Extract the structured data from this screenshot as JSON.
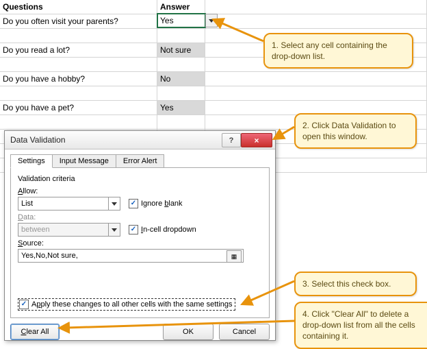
{
  "sheet": {
    "headers": {
      "q": "Questions",
      "a": "Answer"
    },
    "rows": [
      {
        "q": "Do you often visit your parents?",
        "a": "Yes"
      },
      {
        "q": "Do you read a lot?",
        "a": "Not sure"
      },
      {
        "q": "Do you have a hobby?",
        "a": "No"
      },
      {
        "q": "Do you have a pet?",
        "a": "Yes"
      }
    ],
    "selected_answer": "Yes"
  },
  "dialog": {
    "title": "Data Validation",
    "help": "?",
    "close": "×",
    "tabs": {
      "settings": "Settings",
      "input": "Input Message",
      "error": "Error Alert"
    },
    "criteria_title": "Validation criteria",
    "allow_label": "Allow:",
    "allow_value": "List",
    "data_label": "Data:",
    "data_value": "between",
    "ignore_blank": "Ignore blank",
    "incell": "In-cell dropdown",
    "source_label": "Source:",
    "source_value": "Yes,No,Not sure,",
    "apply_label": "Apply these changes to all other cells with the same settings",
    "buttons": {
      "clear": "Clear All",
      "ok": "OK",
      "cancel": "Cancel"
    }
  },
  "callouts": {
    "c1": "1. Select any cell containing the drop-down list.",
    "c2": "2. Click Data Validation to open this window.",
    "c3": "3. Select this check box.",
    "c4": "4. Click \"Clear All\" to delete a drop-down list from all the cells containing it."
  }
}
